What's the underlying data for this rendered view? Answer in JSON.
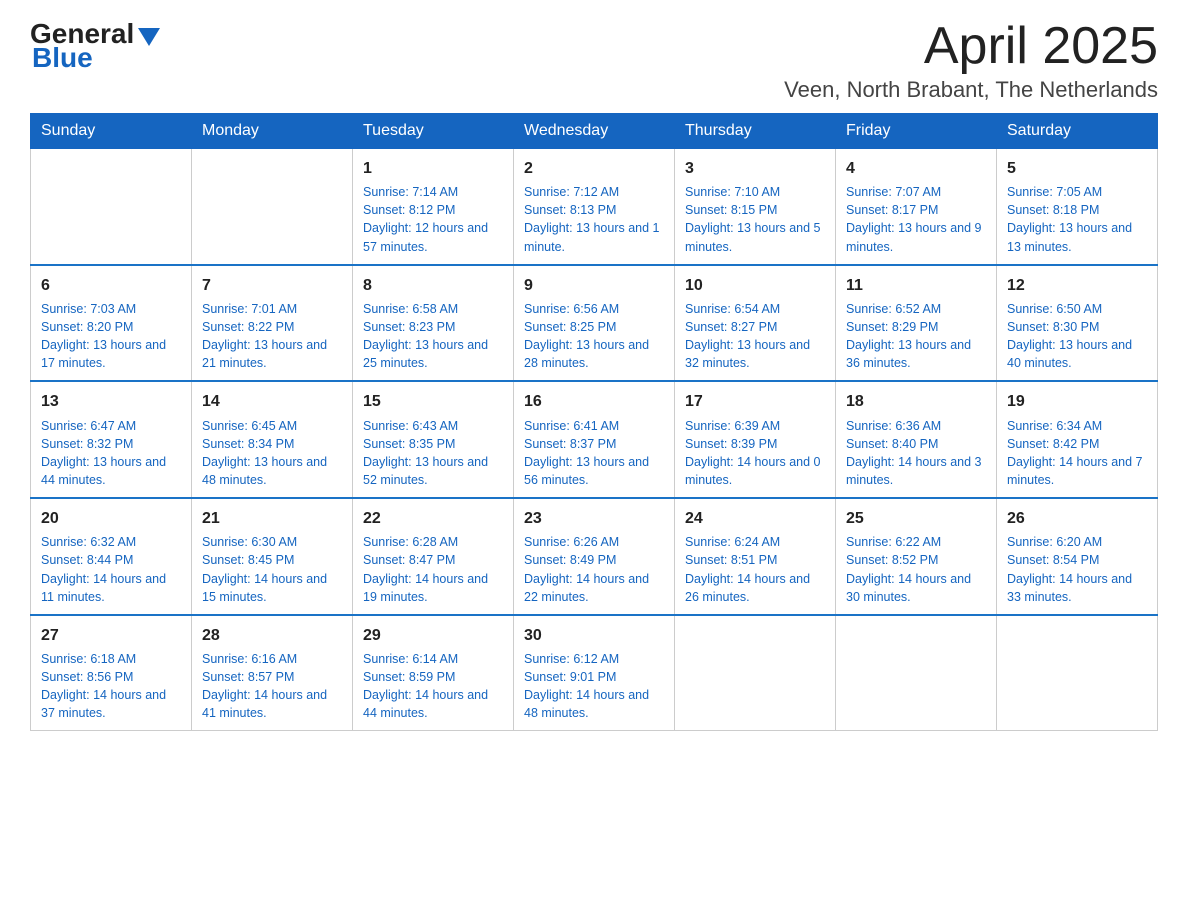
{
  "header": {
    "logo_general": "General",
    "logo_blue": "Blue",
    "title": "April 2025",
    "location": "Veen, North Brabant, The Netherlands"
  },
  "days_of_week": [
    "Sunday",
    "Monday",
    "Tuesday",
    "Wednesday",
    "Thursday",
    "Friday",
    "Saturday"
  ],
  "weeks": [
    [
      {
        "day": "",
        "sunrise": "",
        "sunset": "",
        "daylight": ""
      },
      {
        "day": "",
        "sunrise": "",
        "sunset": "",
        "daylight": ""
      },
      {
        "day": "1",
        "sunrise": "Sunrise: 7:14 AM",
        "sunset": "Sunset: 8:12 PM",
        "daylight": "Daylight: 12 hours and 57 minutes."
      },
      {
        "day": "2",
        "sunrise": "Sunrise: 7:12 AM",
        "sunset": "Sunset: 8:13 PM",
        "daylight": "Daylight: 13 hours and 1 minute."
      },
      {
        "day": "3",
        "sunrise": "Sunrise: 7:10 AM",
        "sunset": "Sunset: 8:15 PM",
        "daylight": "Daylight: 13 hours and 5 minutes."
      },
      {
        "day": "4",
        "sunrise": "Sunrise: 7:07 AM",
        "sunset": "Sunset: 8:17 PM",
        "daylight": "Daylight: 13 hours and 9 minutes."
      },
      {
        "day": "5",
        "sunrise": "Sunrise: 7:05 AM",
        "sunset": "Sunset: 8:18 PM",
        "daylight": "Daylight: 13 hours and 13 minutes."
      }
    ],
    [
      {
        "day": "6",
        "sunrise": "Sunrise: 7:03 AM",
        "sunset": "Sunset: 8:20 PM",
        "daylight": "Daylight: 13 hours and 17 minutes."
      },
      {
        "day": "7",
        "sunrise": "Sunrise: 7:01 AM",
        "sunset": "Sunset: 8:22 PM",
        "daylight": "Daylight: 13 hours and 21 minutes."
      },
      {
        "day": "8",
        "sunrise": "Sunrise: 6:58 AM",
        "sunset": "Sunset: 8:23 PM",
        "daylight": "Daylight: 13 hours and 25 minutes."
      },
      {
        "day": "9",
        "sunrise": "Sunrise: 6:56 AM",
        "sunset": "Sunset: 8:25 PM",
        "daylight": "Daylight: 13 hours and 28 minutes."
      },
      {
        "day": "10",
        "sunrise": "Sunrise: 6:54 AM",
        "sunset": "Sunset: 8:27 PM",
        "daylight": "Daylight: 13 hours and 32 minutes."
      },
      {
        "day": "11",
        "sunrise": "Sunrise: 6:52 AM",
        "sunset": "Sunset: 8:29 PM",
        "daylight": "Daylight: 13 hours and 36 minutes."
      },
      {
        "day": "12",
        "sunrise": "Sunrise: 6:50 AM",
        "sunset": "Sunset: 8:30 PM",
        "daylight": "Daylight: 13 hours and 40 minutes."
      }
    ],
    [
      {
        "day": "13",
        "sunrise": "Sunrise: 6:47 AM",
        "sunset": "Sunset: 8:32 PM",
        "daylight": "Daylight: 13 hours and 44 minutes."
      },
      {
        "day": "14",
        "sunrise": "Sunrise: 6:45 AM",
        "sunset": "Sunset: 8:34 PM",
        "daylight": "Daylight: 13 hours and 48 minutes."
      },
      {
        "day": "15",
        "sunrise": "Sunrise: 6:43 AM",
        "sunset": "Sunset: 8:35 PM",
        "daylight": "Daylight: 13 hours and 52 minutes."
      },
      {
        "day": "16",
        "sunrise": "Sunrise: 6:41 AM",
        "sunset": "Sunset: 8:37 PM",
        "daylight": "Daylight: 13 hours and 56 minutes."
      },
      {
        "day": "17",
        "sunrise": "Sunrise: 6:39 AM",
        "sunset": "Sunset: 8:39 PM",
        "daylight": "Daylight: 14 hours and 0 minutes."
      },
      {
        "day": "18",
        "sunrise": "Sunrise: 6:36 AM",
        "sunset": "Sunset: 8:40 PM",
        "daylight": "Daylight: 14 hours and 3 minutes."
      },
      {
        "day": "19",
        "sunrise": "Sunrise: 6:34 AM",
        "sunset": "Sunset: 8:42 PM",
        "daylight": "Daylight: 14 hours and 7 minutes."
      }
    ],
    [
      {
        "day": "20",
        "sunrise": "Sunrise: 6:32 AM",
        "sunset": "Sunset: 8:44 PM",
        "daylight": "Daylight: 14 hours and 11 minutes."
      },
      {
        "day": "21",
        "sunrise": "Sunrise: 6:30 AM",
        "sunset": "Sunset: 8:45 PM",
        "daylight": "Daylight: 14 hours and 15 minutes."
      },
      {
        "day": "22",
        "sunrise": "Sunrise: 6:28 AM",
        "sunset": "Sunset: 8:47 PM",
        "daylight": "Daylight: 14 hours and 19 minutes."
      },
      {
        "day": "23",
        "sunrise": "Sunrise: 6:26 AM",
        "sunset": "Sunset: 8:49 PM",
        "daylight": "Daylight: 14 hours and 22 minutes."
      },
      {
        "day": "24",
        "sunrise": "Sunrise: 6:24 AM",
        "sunset": "Sunset: 8:51 PM",
        "daylight": "Daylight: 14 hours and 26 minutes."
      },
      {
        "day": "25",
        "sunrise": "Sunrise: 6:22 AM",
        "sunset": "Sunset: 8:52 PM",
        "daylight": "Daylight: 14 hours and 30 minutes."
      },
      {
        "day": "26",
        "sunrise": "Sunrise: 6:20 AM",
        "sunset": "Sunset: 8:54 PM",
        "daylight": "Daylight: 14 hours and 33 minutes."
      }
    ],
    [
      {
        "day": "27",
        "sunrise": "Sunrise: 6:18 AM",
        "sunset": "Sunset: 8:56 PM",
        "daylight": "Daylight: 14 hours and 37 minutes."
      },
      {
        "day": "28",
        "sunrise": "Sunrise: 6:16 AM",
        "sunset": "Sunset: 8:57 PM",
        "daylight": "Daylight: 14 hours and 41 minutes."
      },
      {
        "day": "29",
        "sunrise": "Sunrise: 6:14 AM",
        "sunset": "Sunset: 8:59 PM",
        "daylight": "Daylight: 14 hours and 44 minutes."
      },
      {
        "day": "30",
        "sunrise": "Sunrise: 6:12 AM",
        "sunset": "Sunset: 9:01 PM",
        "daylight": "Daylight: 14 hours and 48 minutes."
      },
      {
        "day": "",
        "sunrise": "",
        "sunset": "",
        "daylight": ""
      },
      {
        "day": "",
        "sunrise": "",
        "sunset": "",
        "daylight": ""
      },
      {
        "day": "",
        "sunrise": "",
        "sunset": "",
        "daylight": ""
      }
    ]
  ]
}
